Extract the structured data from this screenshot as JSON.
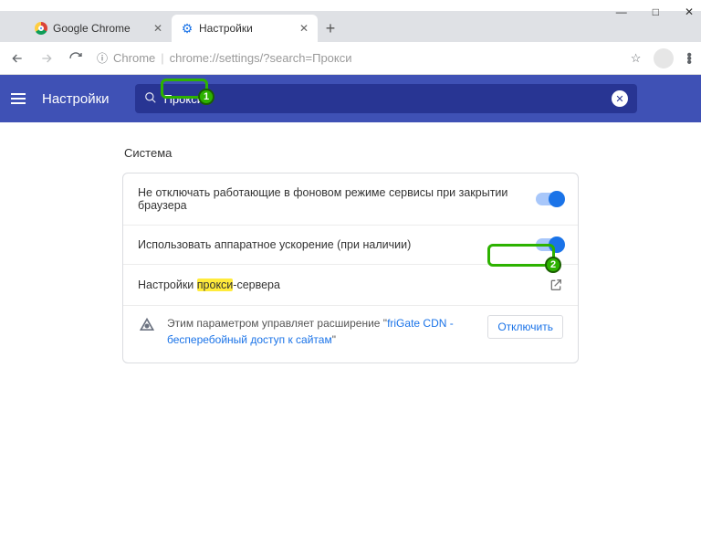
{
  "window": {
    "tabs": [
      {
        "label": "Google Chrome",
        "active": false,
        "icon": "chrome"
      },
      {
        "label": "Настройки",
        "active": true,
        "icon": "gear"
      }
    ],
    "url_prefix": "Chrome",
    "url_path": "chrome://settings/?search=Прокси"
  },
  "toolbar": {
    "title": "Настройки",
    "search_value": "Прокси"
  },
  "section": {
    "title": "Система",
    "rows": [
      {
        "label": "Не отключать работающие в фоновом режиме сервисы при закрытии браузера"
      },
      {
        "label": "Использовать аппаратное ускорение (при наличии)"
      }
    ],
    "proxy_row": {
      "prefix": "Настройки ",
      "highlight": "прокси",
      "suffix": "-сервера"
    },
    "extension_notice": {
      "prefix": "Этим параметром управляет расширение \"",
      "link": "friGate CDN - бесперебойный доступ к сайтам",
      "suffix": "\""
    },
    "disable_label": "Отключить"
  }
}
